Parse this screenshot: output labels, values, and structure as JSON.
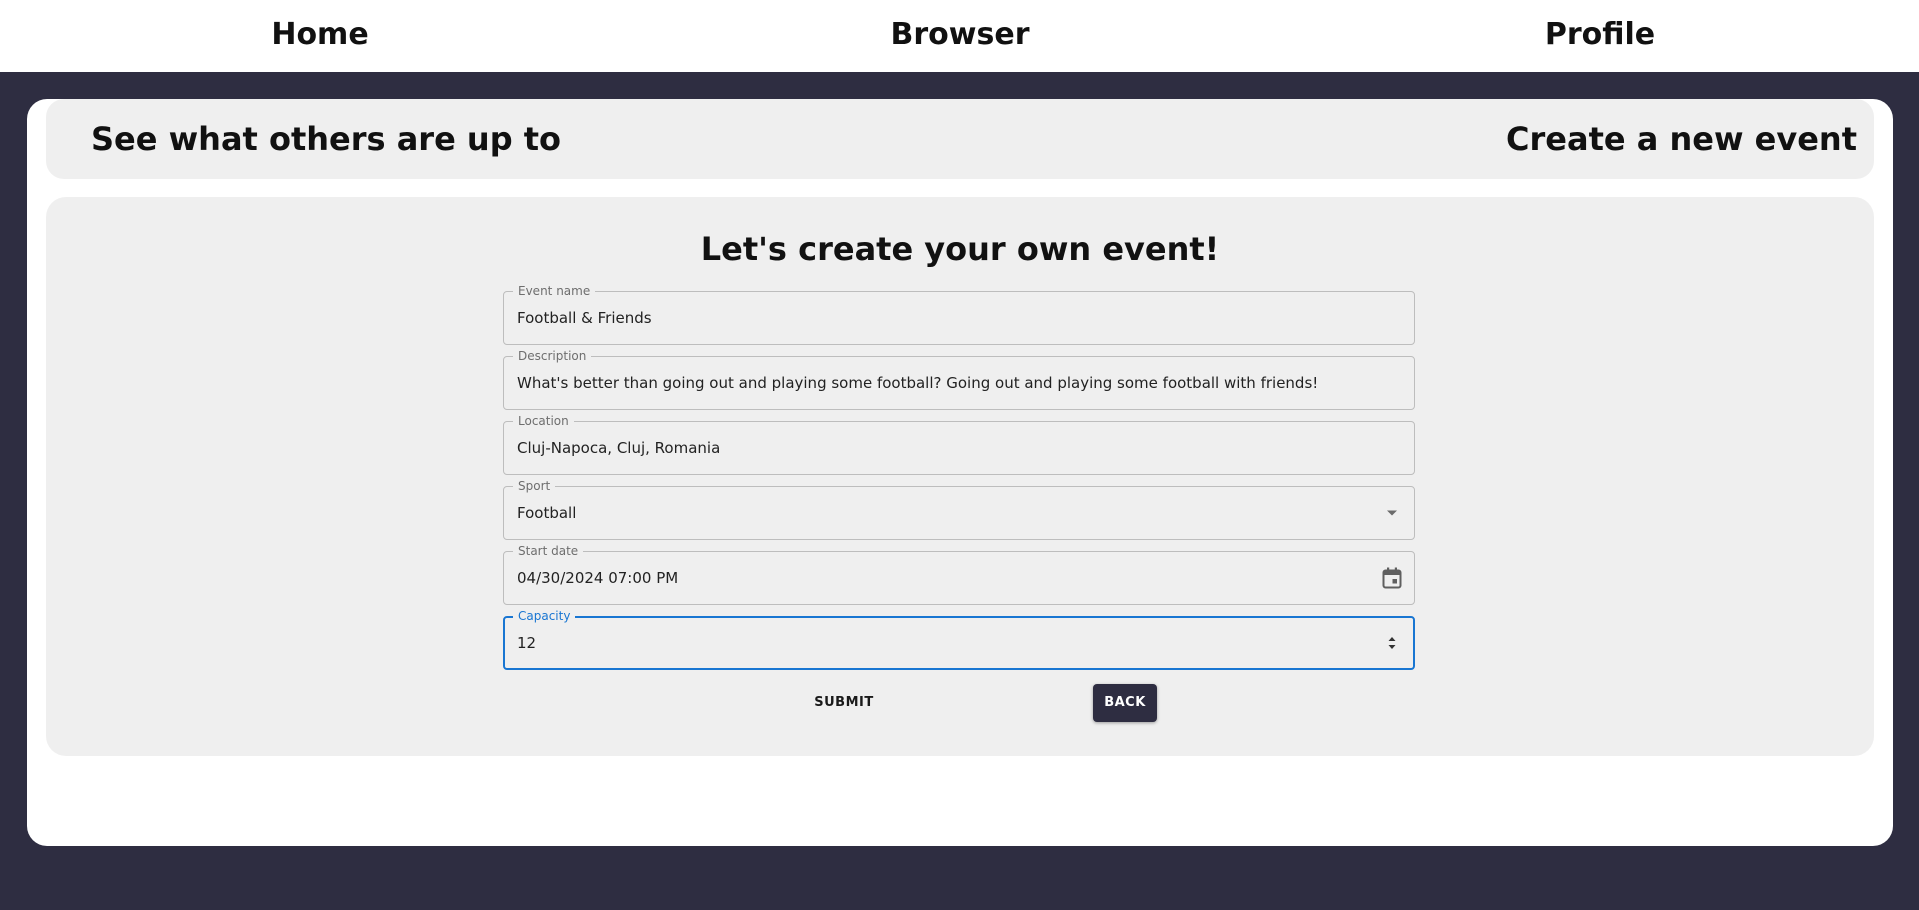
{
  "nav": {
    "home": "Home",
    "browser": "Browser",
    "profile": "Profile"
  },
  "subnav": {
    "left": "See what others are up to",
    "right": "Create a new event"
  },
  "form": {
    "title": "Let's create your own event!",
    "event_name": {
      "label": "Event name",
      "value": "Football & Friends"
    },
    "description": {
      "label": "Description",
      "value": "What's better than going out and playing some football? Going out and playing some football with friends!"
    },
    "location": {
      "label": "Location",
      "value": "Cluj-Napoca, Cluj, Romania"
    },
    "sport": {
      "label": "Sport",
      "value": "Football"
    },
    "start_date": {
      "label": "Start date",
      "value": "04/30/2024 07:00 PM"
    },
    "capacity": {
      "label": "Capacity",
      "value": "12"
    },
    "submit_label": "SUBMIT",
    "back_label": "BACK"
  },
  "icons": {
    "sport_dropdown": "dropdown-arrow-icon",
    "calendar": "calendar-icon",
    "stepper": "spin-stepper-icon"
  },
  "colors": {
    "background": "#2e2d41",
    "panel": "#efefef",
    "focus": "#1976d2",
    "back_button": "#2e2d41"
  }
}
